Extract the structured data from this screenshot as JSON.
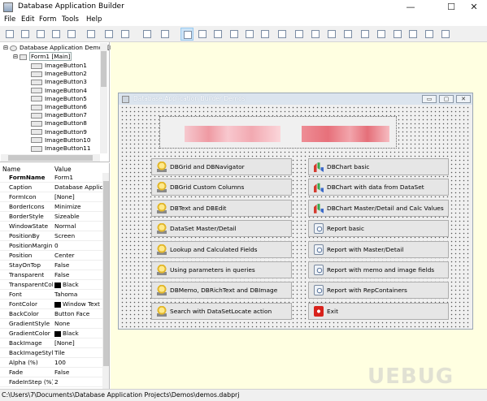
{
  "window": {
    "title": "Database Application Builder",
    "min_glyph": "—",
    "max_glyph": "☐",
    "close_glyph": "✕"
  },
  "menu": [
    "File",
    "Edit",
    "Form",
    "Tools",
    "Help"
  ],
  "toolbar_icons": [
    "new-icon",
    "open-icon",
    "save-icon",
    "save-as-icon",
    "run-icon",
    "build-icon",
    "copy-icon",
    "paste-icon",
    "new-form-icon",
    "preview-icon",
    "pointer-icon",
    "panel-icon",
    "groupbox-icon",
    "frame-icon",
    "bevel-icon",
    "splitter-icon",
    "edit-icon",
    "memo-icon",
    "image-icon",
    "label-icon",
    "dbgrid-icon",
    "dbedit-icon",
    "dbcheckbox-icon",
    "dbradio-icon",
    "dbcombo-icon",
    "dbimage-icon",
    "dbnavigator-icon"
  ],
  "tree": {
    "root": "Database Application Demos [F",
    "form": "Form1 [Main]",
    "items": [
      "ImageButton1",
      "ImageButton2",
      "ImageButton3",
      "ImageButton4",
      "ImageButton5",
      "ImageButton6",
      "ImageButton7",
      "ImageButton8",
      "ImageButton9",
      "ImageButton10",
      "ImageButton11"
    ]
  },
  "props": {
    "col_name": "Name",
    "col_value": "Value",
    "rows": [
      {
        "name": "FormName",
        "value": "Form1"
      },
      {
        "name": "Caption",
        "value": "Database Applica"
      },
      {
        "name": "FormIcon",
        "value": "[None]"
      },
      {
        "name": "BorderIcons",
        "value": "Minimize"
      },
      {
        "name": "BorderStyle",
        "value": "Sizeable"
      },
      {
        "name": "WindowState",
        "value": "Normal"
      },
      {
        "name": "PositionBy",
        "value": "Screen"
      },
      {
        "name": "PositionMargin",
        "value": "0"
      },
      {
        "name": "Position",
        "value": "Center"
      },
      {
        "name": "StayOnTop",
        "value": "False"
      },
      {
        "name": "Transparent",
        "value": "False"
      },
      {
        "name": "TransparentColor",
        "value": "Black"
      },
      {
        "name": "Font",
        "value": "Tahoma"
      },
      {
        "name": "FontColor",
        "value": "Window Text"
      },
      {
        "name": "BackColor",
        "value": "Button Face"
      },
      {
        "name": "GradientStyle",
        "value": "None"
      },
      {
        "name": "GradientColor",
        "value": "Black"
      },
      {
        "name": "BackImage",
        "value": "[None]"
      },
      {
        "name": "BackImageStyle",
        "value": "Tile"
      },
      {
        "name": "Alpha (%)",
        "value": "100"
      },
      {
        "name": "Fade",
        "value": "False"
      },
      {
        "name": "FadeInStep (%)",
        "value": "2"
      }
    ]
  },
  "form": {
    "title": "Database Application Builder Demos",
    "buttons_left": [
      "DBGrid and DBNavigator",
      "DBGrid Custom Columns",
      "DBText and DBEdit",
      "DataSet Master/Detail",
      "Lookup and Calculated Fields",
      "Using parameters in queries",
      "DBMemo, DBRichText and DBImage",
      "Search with DataSetLocate action"
    ],
    "buttons_right": [
      "DBChart basic",
      "DBChart with data from DataSet",
      "DBChart Master/Detail and Calc Values",
      "Report basic",
      "Report with Master/Detail",
      "Report with memo and image fields",
      "Report with RepContainers",
      "Exit"
    ],
    "icons_right": [
      "chart",
      "chart",
      "chart",
      "report",
      "report",
      "report",
      "report",
      "exit"
    ]
  },
  "status": {
    "path": "C:\\Users\\7\\Documents\\Database Application Projects\\Demos\\demos.dabprj"
  },
  "watermark": "UEBUG"
}
